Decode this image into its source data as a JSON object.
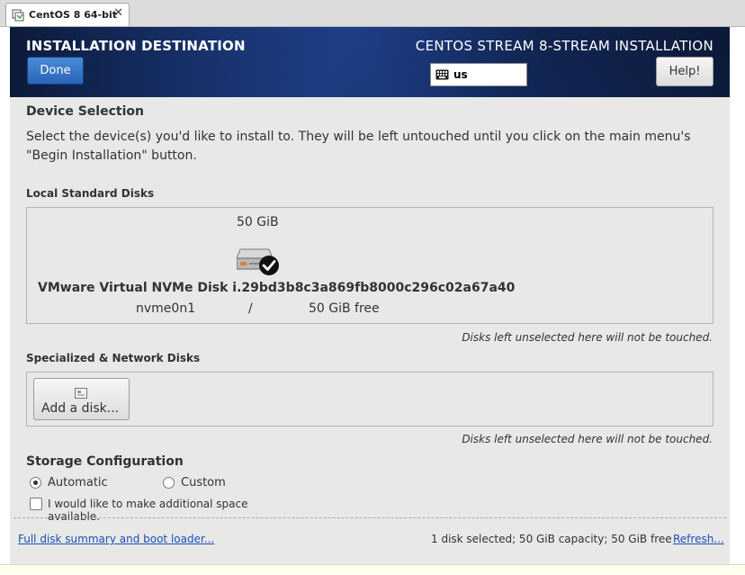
{
  "vm_tab": {
    "title": "CentOS 8 64-bit",
    "close": "✕"
  },
  "header": {
    "title": "INSTALLATION DESTINATION",
    "product": "CENTOS STREAM 8-STREAM INSTALLATION",
    "done_label": "Done",
    "help_label": "Help!",
    "keyboard_layout": "us"
  },
  "device_selection": {
    "title": "Device Selection",
    "description": "Select the device(s) you'd like to install to.  They will be left untouched until you click on the main menu's \"Begin Installation\" button."
  },
  "local_disks": {
    "title": "Local Standard Disks",
    "disks": [
      {
        "capacity": "50 GiB",
        "name": "VMware Virtual NVMe Disk i.29bd3b8c3a869fb8000c296c02a67a40",
        "device": "nvme0n1",
        "mount": "/",
        "free": "50 GiB free",
        "selected": true,
        "icon": "hard-disk-icon"
      }
    ],
    "hint": "Disks left unselected here will not be touched."
  },
  "network_disks": {
    "title": "Specialized & Network Disks",
    "add_label": "Add a disk...",
    "hint": "Disks left unselected here will not be touched."
  },
  "storage": {
    "title": "Storage Configuration",
    "automatic_label": "Automatic",
    "custom_label": "Custom",
    "selected": "automatic",
    "space_label": "I would like to make additional space available.",
    "space_checked": false
  },
  "footer": {
    "summary_link": "Full disk summary and boot loader...",
    "status": "1 disk selected; 50 GiB capacity; 50 GiB free",
    "refresh_link": "Refresh..."
  },
  "colors": {
    "header_bg": "#0f1d3d",
    "done_button": "#2a64b8",
    "link": "#1a4fb8",
    "window_bg": "#e8e8e7"
  }
}
